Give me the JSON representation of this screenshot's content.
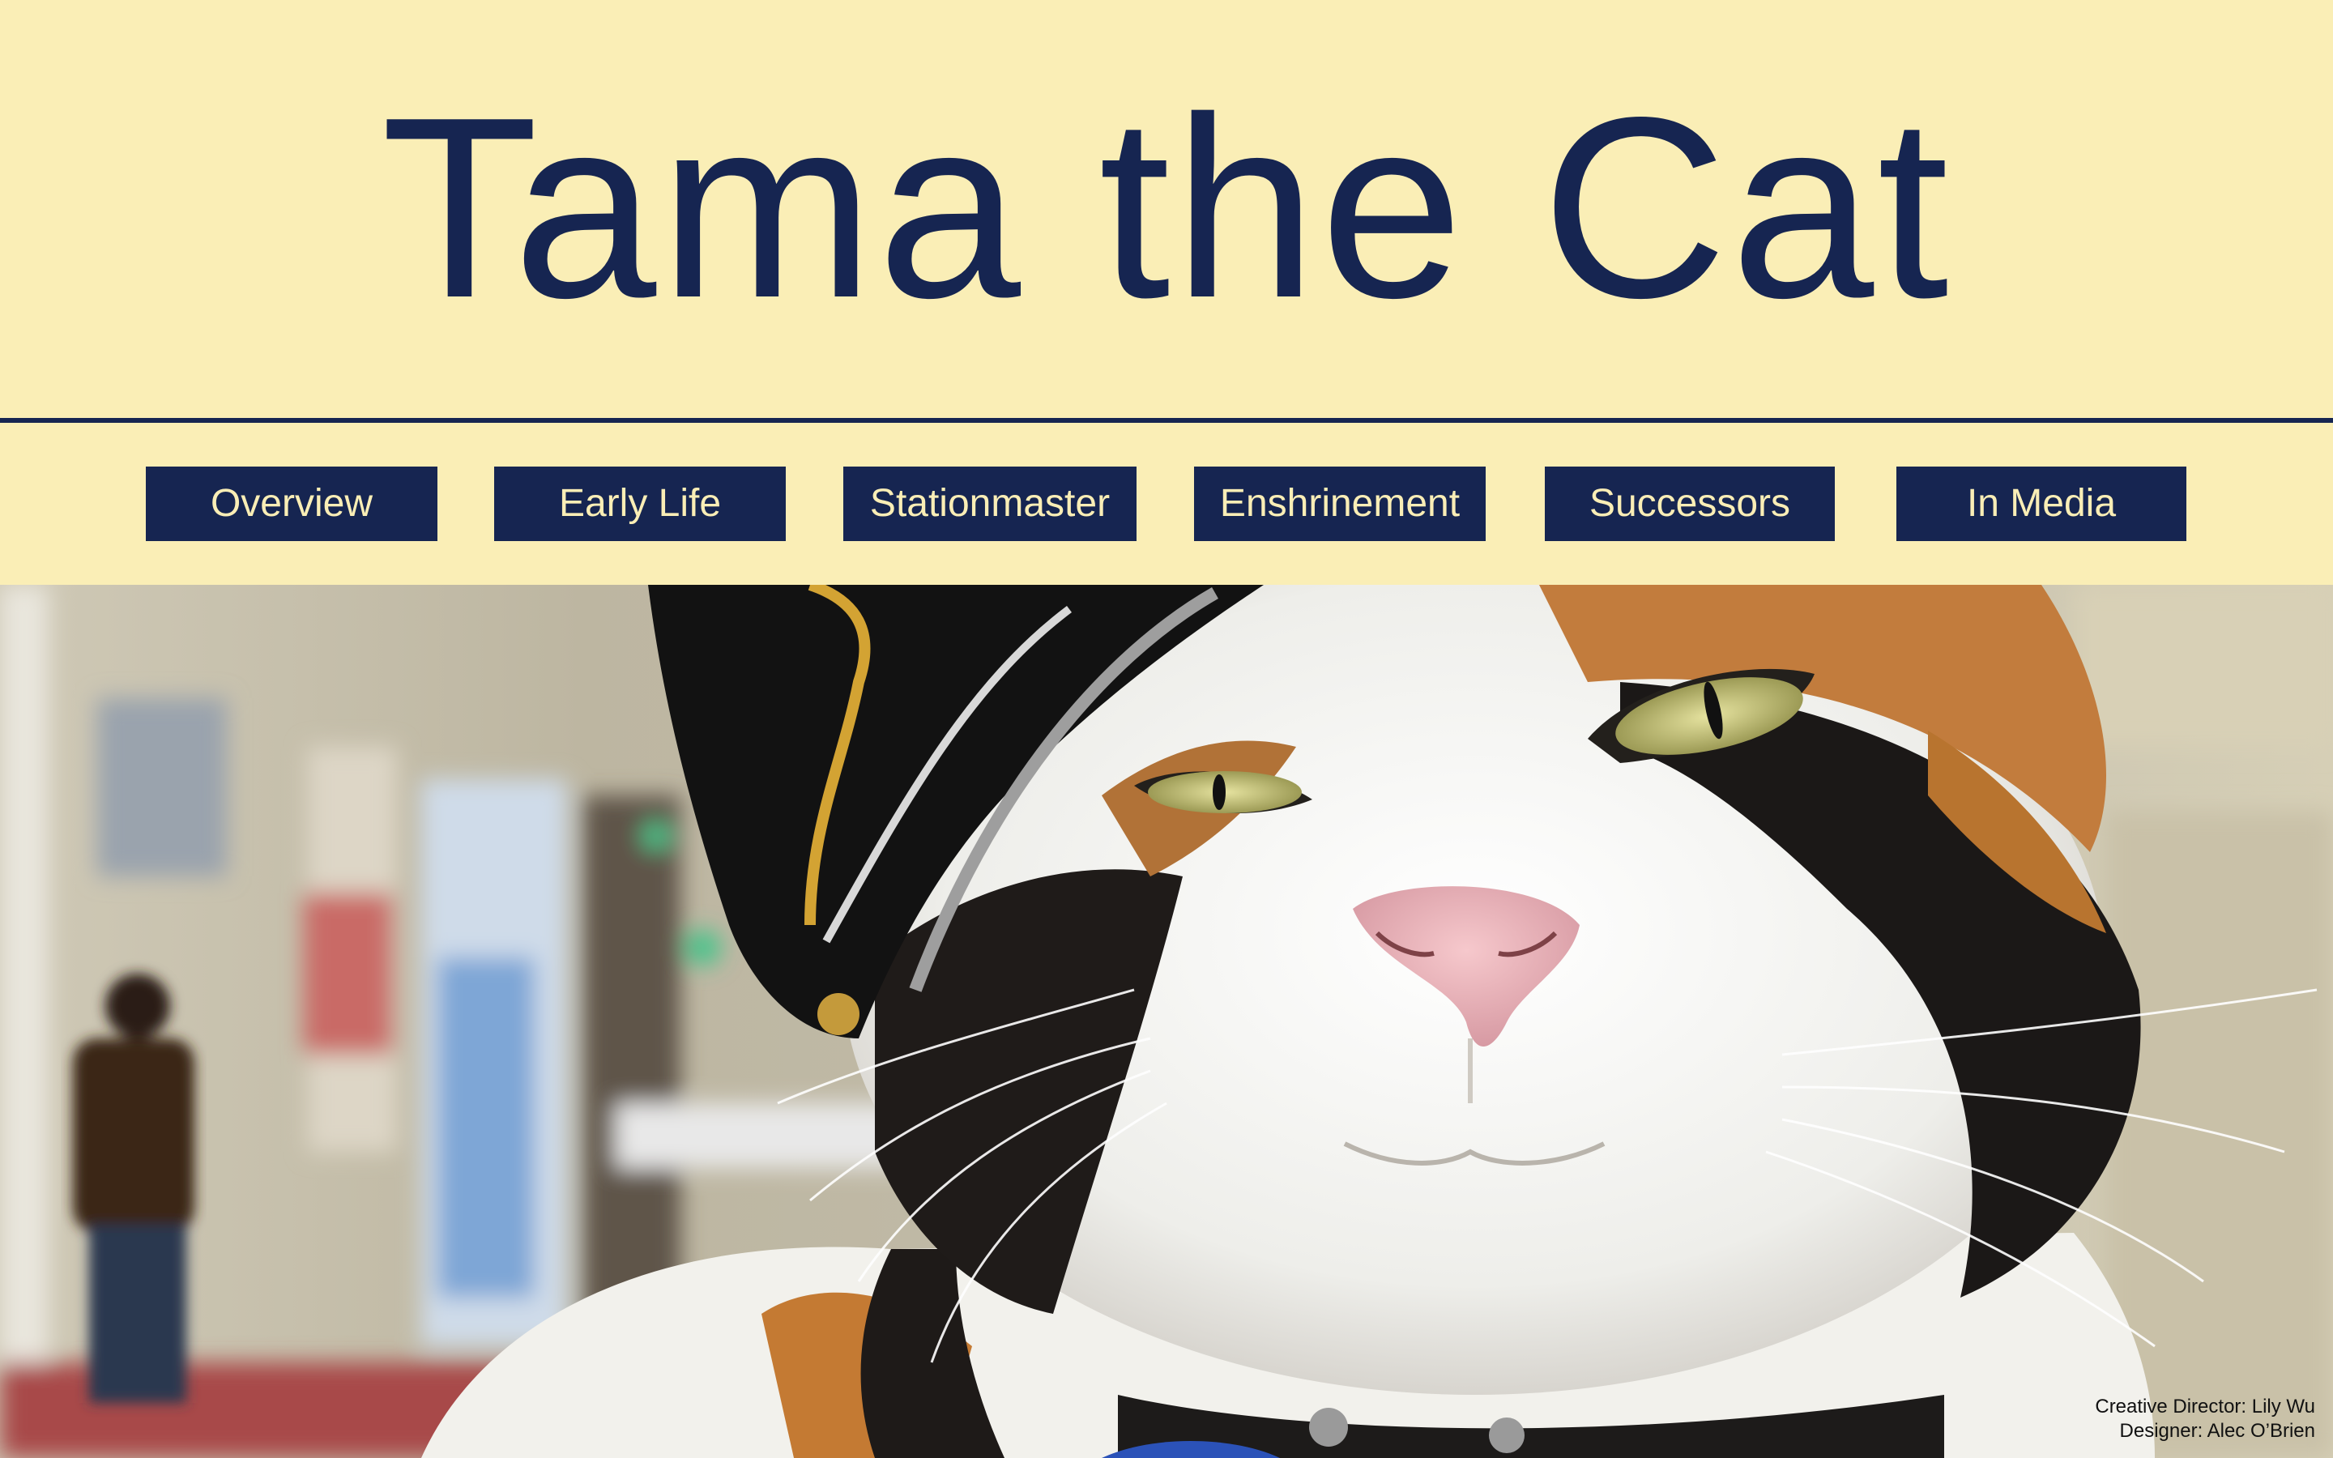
{
  "header": {
    "title": "Tama the Cat"
  },
  "nav": {
    "items": [
      {
        "label": "Overview"
      },
      {
        "label": "Early Life"
      },
      {
        "label": "Stationmaster"
      },
      {
        "label": "Enshrinement"
      },
      {
        "label": "Successors"
      },
      {
        "label": "In Media"
      }
    ]
  },
  "hero": {
    "image": "photo of a calico cat wearing a black stationmaster cap"
  },
  "credits": {
    "creative_director": "Creative Director: Lily Wu",
    "designer": "Designer: Alec O’Brien"
  },
  "colors": {
    "background": "#faeeb6",
    "accent": "#162551",
    "nav_text": "#faeeb6"
  }
}
